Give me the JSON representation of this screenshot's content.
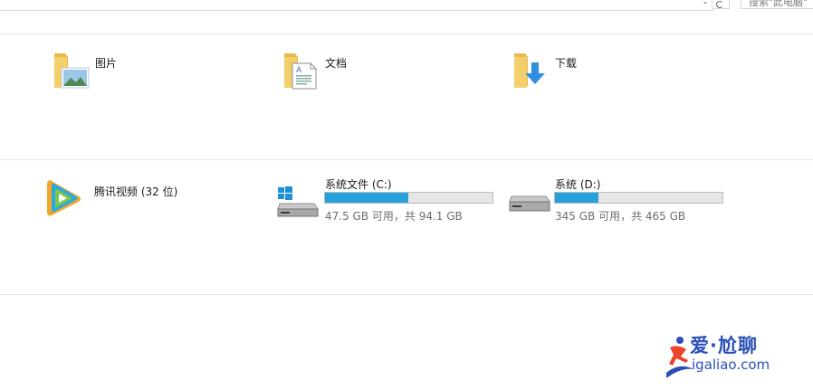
{
  "header": {
    "search_placeholder": "搜索\"此电脑\"",
    "dropdown_glyph": "⌄"
  },
  "folders": [
    {
      "label": "图片",
      "icon": "pictures-folder-icon"
    },
    {
      "label": "文档",
      "icon": "documents-folder-icon"
    },
    {
      "label": "下载",
      "icon": "downloads-folder-icon"
    }
  ],
  "devices": {
    "app": {
      "label": "腾讯视频 (32 位)",
      "icon": "tencent-video-icon"
    },
    "drives": [
      {
        "label": "系统文件 (C:)",
        "free_text": "47.5 GB 可用，共 94.1 GB",
        "used_fraction": 0.495,
        "icon": "windows-drive-icon"
      },
      {
        "label": "系统 (D:)",
        "free_text": "345 GB 可用，共 465 GB",
        "used_fraction": 0.258,
        "icon": "hard-drive-icon"
      }
    ]
  },
  "colors": {
    "accent": "#26a0da",
    "watermark": "#2b4fb7"
  },
  "watermark": {
    "cn": "爱·尬聊",
    "url": "igaliao.com"
  }
}
